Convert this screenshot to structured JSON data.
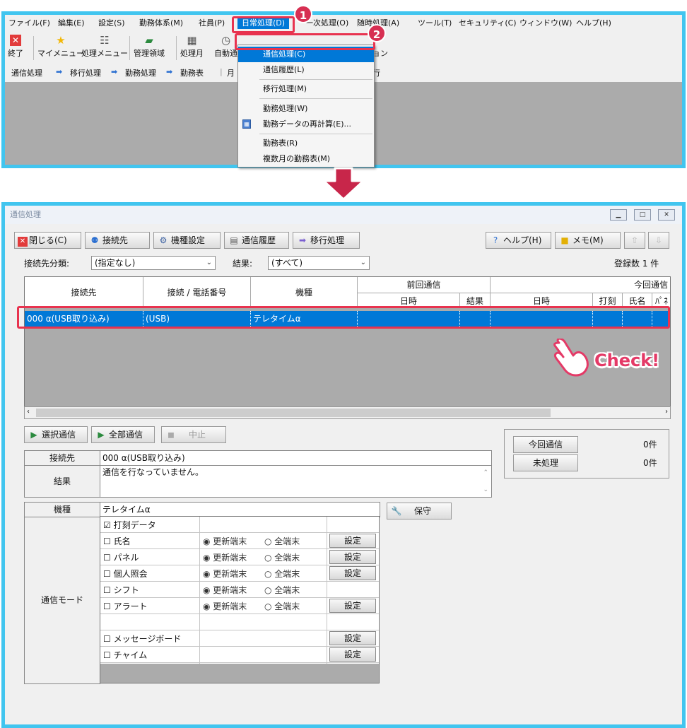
{
  "menubar": {
    "items": [
      "ファイル(F)",
      "編集(E)",
      "設定(S)",
      "勤務体系(M)",
      "社員(P)",
      "日常処理(D)",
      "一次処理(O)",
      "随時処理(A)",
      "ツール(T)",
      "セキュリティ(C)",
      "ウィンドウ(W)",
      "ヘルプ(H)"
    ]
  },
  "toolbar": {
    "items": [
      "終了",
      "マイメニュー",
      "処理メニュー",
      "管理領域",
      "処理月",
      "自動通",
      "通信オプション"
    ]
  },
  "flowbar": {
    "steps": [
      "通信処理",
      "移行処理",
      "勤務処理",
      "勤務表",
      "月",
      "行"
    ]
  },
  "dropdown": {
    "items": [
      "通信処理(C)",
      "通信履歴(L)",
      "移行処理(M)",
      "勤務処理(W)",
      "勤務データの再計算(E)...",
      "勤務表(R)",
      "複数月の勤務表(M)"
    ]
  },
  "badges": {
    "one": "1",
    "two": "2"
  },
  "window": {
    "title": "通信処理",
    "buttons": {
      "close": "閉じる(C)",
      "connection": "接続先",
      "model": "機種設定",
      "history": "通信履歴",
      "migrate": "移行処理",
      "help": "ヘルプ(H)",
      "memo": "メモ(M)"
    },
    "filter": {
      "category_label": "接続先分類:",
      "category_value": "(指定なし)",
      "result_label": "結果:",
      "result_value": "(すべて)",
      "count": "登録数 1 件"
    }
  },
  "grid": {
    "headers": {
      "dest": "接続先",
      "phone": "接続 / 電話番号",
      "model": "機種",
      "prev": "前回通信",
      "prev_dt": "日時",
      "prev_res": "結果",
      "cur": "今回通信",
      "cur_dt": "日時",
      "cur_stamp": "打刻",
      "cur_name": "氏名",
      "cur_panel": "ﾊﾟﾈ"
    },
    "row": {
      "dest": "000 α(USB取り込み)",
      "phone": "(USB)",
      "model": "テレタイムα"
    }
  },
  "check": {
    "label": "Check!"
  },
  "actions": {
    "select": "選択通信",
    "all": "全部通信",
    "stop": "中止"
  },
  "counts": {
    "current_label": "今回通信",
    "current_value": "0件",
    "pending_label": "未処理",
    "pending_value": "0件"
  },
  "detail": {
    "dest_label": "接続先",
    "dest_value": "000 α(USB取り込み)",
    "result_label": "結果",
    "result_value": "通信を行なっていません。",
    "model_label": "機種",
    "model_value": "テレタイムα",
    "maint": "保守",
    "mode_label": "通信モード"
  },
  "modes": {
    "radio_update": "更新端末",
    "radio_all": "全端末",
    "setting": "設定",
    "rows": [
      "打刻データ",
      "氏名",
      "パネル",
      "個人照会",
      "シフト",
      "アラート",
      "",
      "メッセージボード",
      "チャイム"
    ]
  }
}
